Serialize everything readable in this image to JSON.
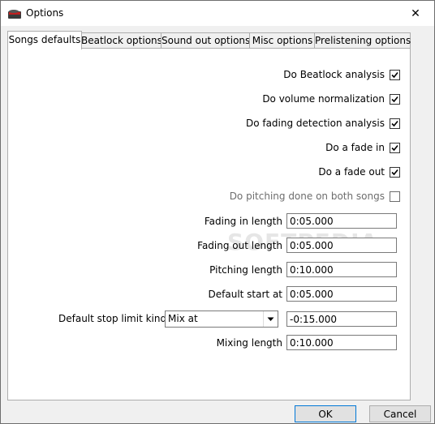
{
  "window": {
    "title": "Options",
    "close_glyph": "✕"
  },
  "tabs": [
    {
      "label": "Songs defaults"
    },
    {
      "label": "Beatlock options"
    },
    {
      "label": "Sound out options"
    },
    {
      "label": "Misc options"
    },
    {
      "label": "Prelistening options"
    }
  ],
  "checks": [
    {
      "label": "Do Beatlock analysis",
      "checked": true,
      "enabled": true
    },
    {
      "label": "Do volume normalization",
      "checked": true,
      "enabled": true
    },
    {
      "label": "Do fading detection analysis",
      "checked": true,
      "enabled": true
    },
    {
      "label": "Do a fade in",
      "checked": true,
      "enabled": true
    },
    {
      "label": "Do a fade out",
      "checked": true,
      "enabled": true
    },
    {
      "label": "Do pitching done on both songs",
      "checked": false,
      "enabled": false
    }
  ],
  "fields": [
    {
      "label": "Fading in length",
      "value": "0:05.000"
    },
    {
      "label": "Fading out length",
      "value": "0:05.000"
    },
    {
      "label": "Pitching length",
      "value": "0:10.000"
    },
    {
      "label": "Default start at",
      "value": "0:05.000"
    }
  ],
  "stop_limit": {
    "label": "Default stop limit kind",
    "selected": "Mix at",
    "value": "-0:15.000"
  },
  "mixing": {
    "label": "Mixing length",
    "value": "0:10.000"
  },
  "buttons": {
    "ok": "OK",
    "cancel": "Cancel"
  },
  "watermark": "SOFTPEDIA"
}
